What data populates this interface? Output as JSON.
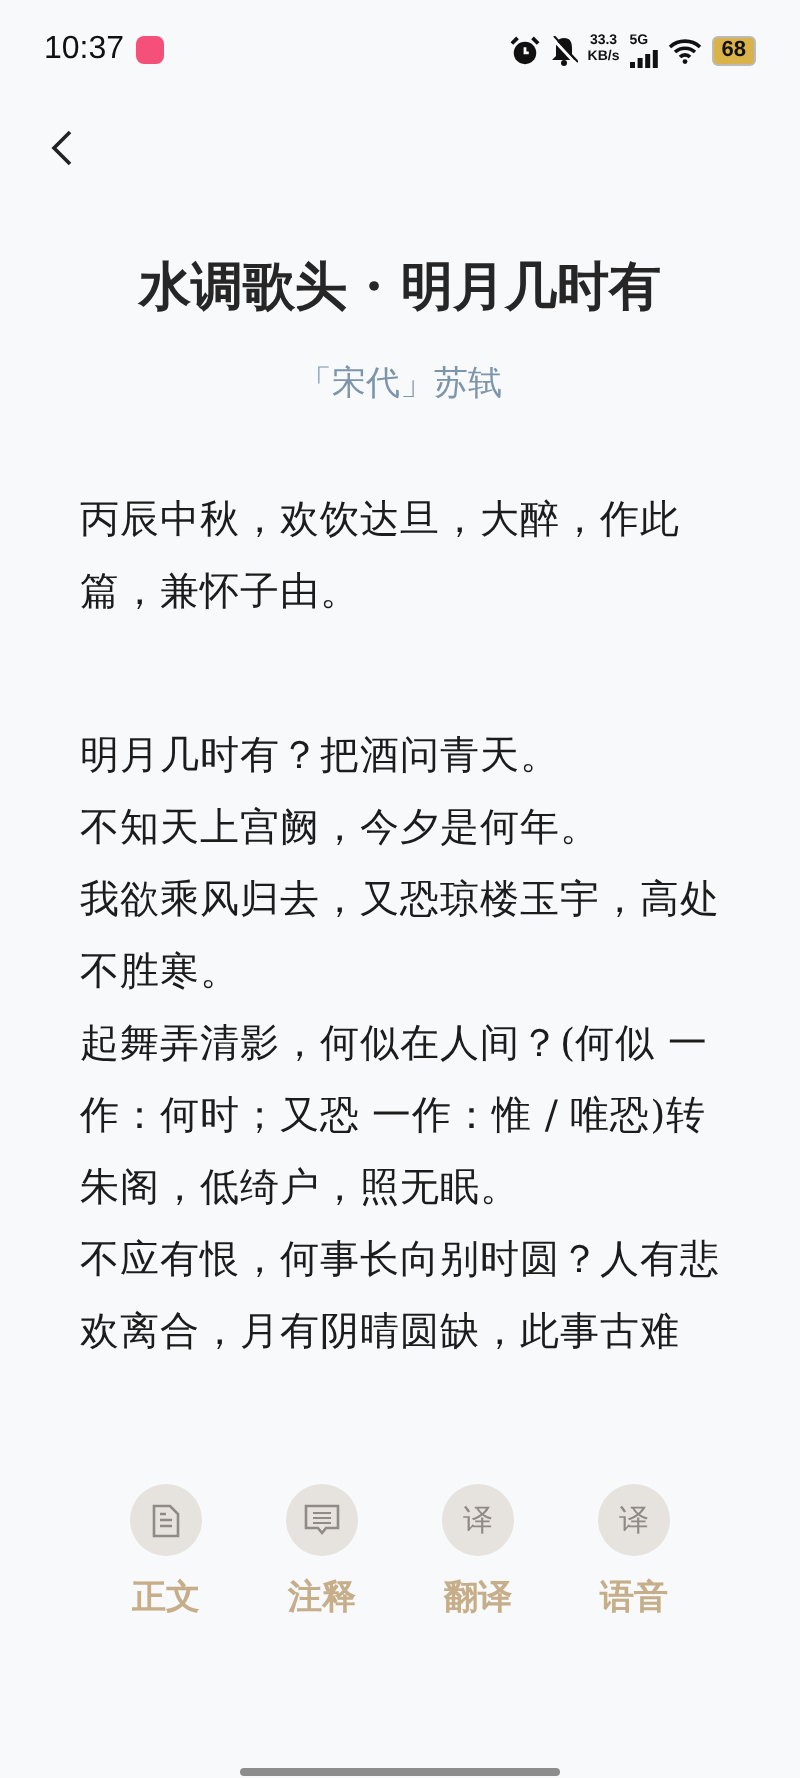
{
  "status_bar": {
    "time": "10:37",
    "speed_value": "33.3",
    "speed_unit": "KB/s",
    "network": "5G",
    "battery": "68"
  },
  "title": "水调歌头 · 明月几时有",
  "author": {
    "dynasty": "「宋代」",
    "name": "苏轼"
  },
  "preface": "丙辰中秋，欢饮达旦，大醉，作此篇，兼怀子由。",
  "verses": [
    "明月几时有？把酒问青天。",
    "不知天上宫阙，今夕是何年。",
    "我欲乘风归去，又恐琼楼玉宇，高处不胜寒。",
    "起舞弄清影，何似在人间？(何似 一作：何时；又恐 一作：惟 / 唯恐)转朱阁，低绮户，照无眠。",
    "不应有恨，何事长向别时圆？人有悲欢离合，月有阴晴圆缺，此事古难"
  ],
  "tabs": [
    {
      "label": "正文",
      "kind": "document"
    },
    {
      "label": "注释",
      "kind": "comment"
    },
    {
      "label": "翻译",
      "kind": "glyph",
      "glyph": "译"
    },
    {
      "label": "语音",
      "kind": "glyph",
      "glyph": "译"
    }
  ]
}
